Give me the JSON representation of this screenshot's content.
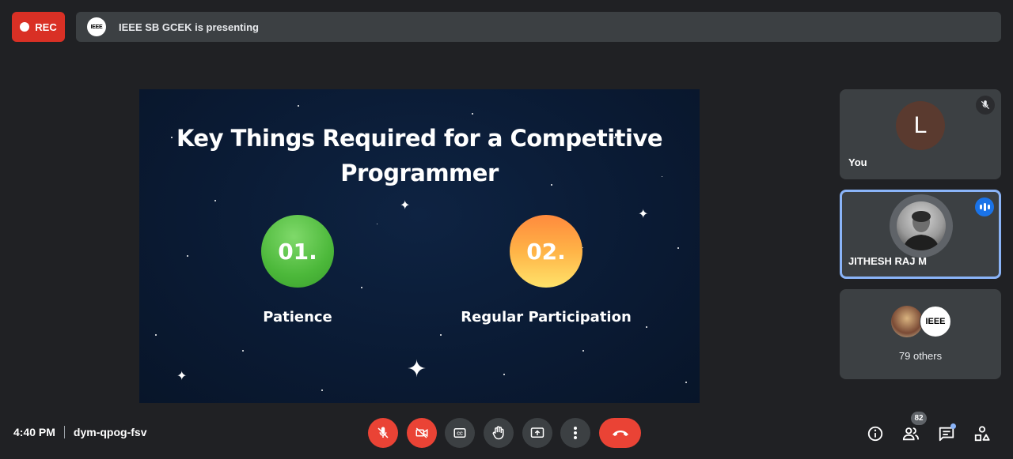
{
  "top_bar": {
    "rec_label": "REC",
    "presenter_logo": "IEEE",
    "presenting_text": "IEEE SB GCEK is presenting"
  },
  "slide": {
    "title_line1": "Key Things Required for a Competitive",
    "title_line2": "Programmer",
    "items": [
      {
        "number": "01.",
        "label": "Patience"
      },
      {
        "number": "02.",
        "label": "Regular Participation"
      }
    ]
  },
  "participants": {
    "self": {
      "initial": "L",
      "name": "You",
      "muted": true
    },
    "speaker": {
      "name": "JITHESH RAJ M",
      "speaking": true
    },
    "others": {
      "logo": "IEEE",
      "label": "79 others"
    }
  },
  "bottom_bar": {
    "time": "4:40 PM",
    "meeting_code": "dym-qpog-fsv",
    "people_count": "82"
  },
  "colors": {
    "background": "#202124",
    "accent_red": "#ea4335",
    "accent_blue": "#8ab4f8",
    "speaking_blue": "#1a73e8"
  },
  "icons": {
    "controls": [
      "mic-off-icon",
      "camera-off-icon",
      "captions-icon",
      "raise-hand-icon",
      "present-icon",
      "more-options-icon",
      "end-call-icon"
    ],
    "right": [
      "info-icon",
      "people-icon",
      "chat-icon",
      "activities-icon"
    ]
  }
}
